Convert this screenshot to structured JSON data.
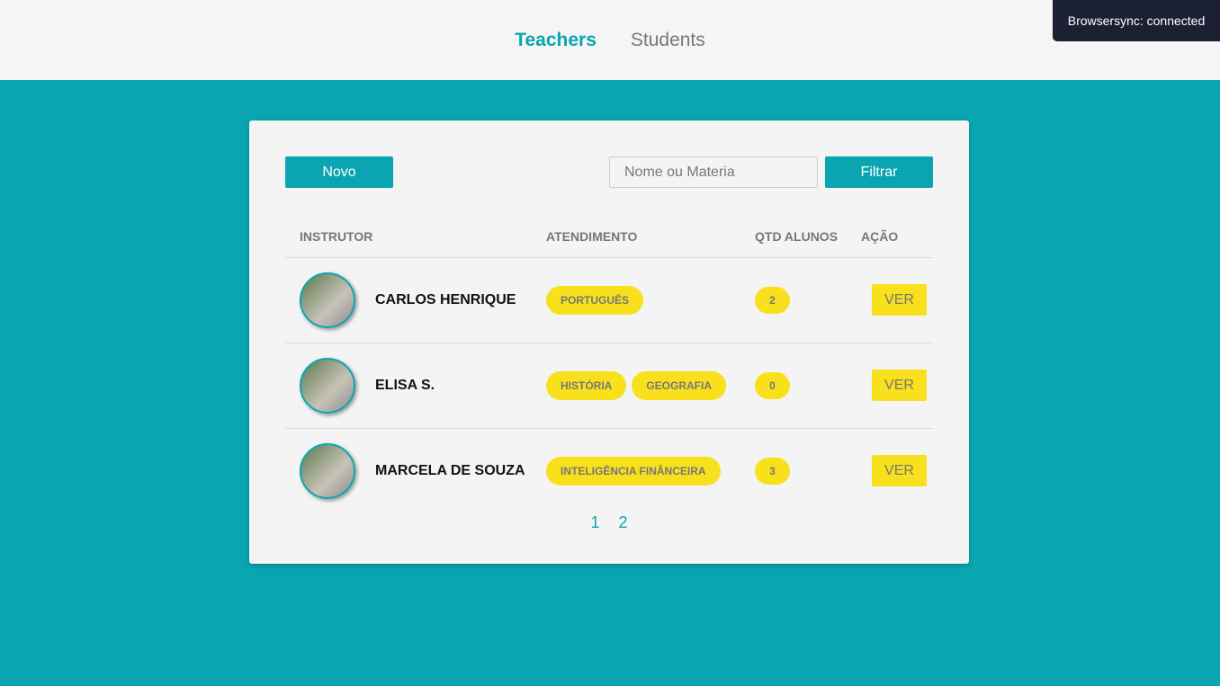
{
  "nav": {
    "items": [
      {
        "label": "Teachers",
        "active": true
      },
      {
        "label": "Students",
        "active": false
      }
    ]
  },
  "toast": "Browsersync: connected",
  "toolbar": {
    "new_label": "Novo",
    "search_placeholder": "Nome ou Materia",
    "filter_label": "Filtrar"
  },
  "table": {
    "headers": [
      "INSTRUTOR",
      "ATENDIMENTO",
      "QTD ALUNOS",
      "AÇÃO"
    ],
    "rows": [
      {
        "name": "CARLOS HENRIQUE",
        "subjects": [
          "PORTUGUÊS"
        ],
        "students": "2",
        "action": "VER"
      },
      {
        "name": "ELISA S.",
        "subjects": [
          "HISTÓRIA",
          "GEOGRAFIA"
        ],
        "students": "0",
        "action": "VER"
      },
      {
        "name": "MARCELA DE SOUZA",
        "subjects": [
          "INTELIGÊNCIA FINÂNCEIRA"
        ],
        "students": "3",
        "action": "VER"
      }
    ]
  },
  "pagination": [
    "1",
    "2"
  ],
  "colors": {
    "accent": "#0aa5b0",
    "badge": "#f8e01c"
  }
}
